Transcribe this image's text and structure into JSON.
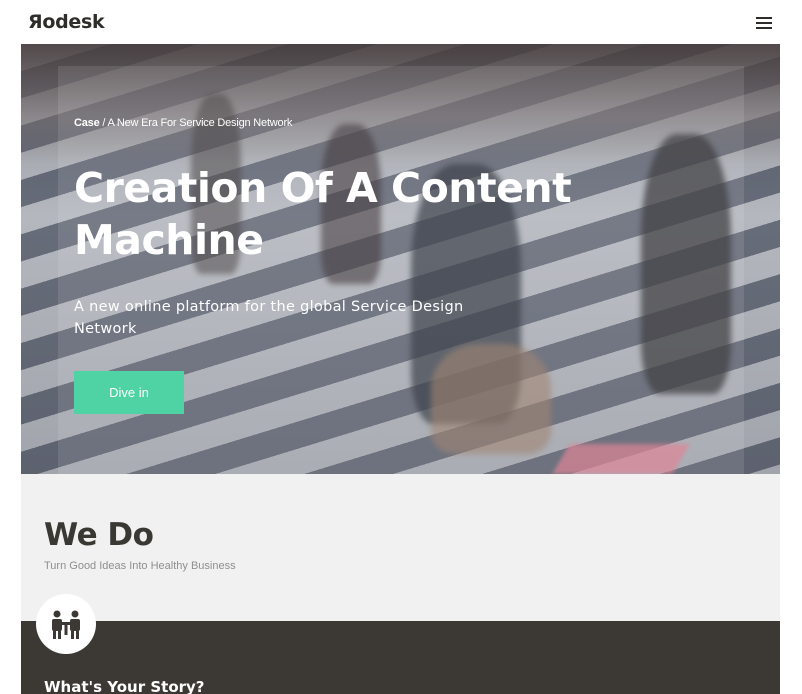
{
  "header": {
    "logo": "Яodesk",
    "menu_icon": "hamburger-menu-icon"
  },
  "hero": {
    "breadcrumb_case": "Case",
    "breadcrumb_separator": " / ",
    "breadcrumb_page": "A New Era For Service Design Network",
    "title": "Creation Of A Content Machine",
    "subtitle": "A new online platform for the global Service Design Network",
    "cta_label": "Dive in",
    "cta_color": "#4fd3a4"
  },
  "wedo": {
    "title": "We Do",
    "subtitle": "Turn Good Ideas Into Healthy Business"
  },
  "story": {
    "icon": "people-meeting-icon",
    "title": "What's Your Story?",
    "background_color": "#3c3934"
  }
}
